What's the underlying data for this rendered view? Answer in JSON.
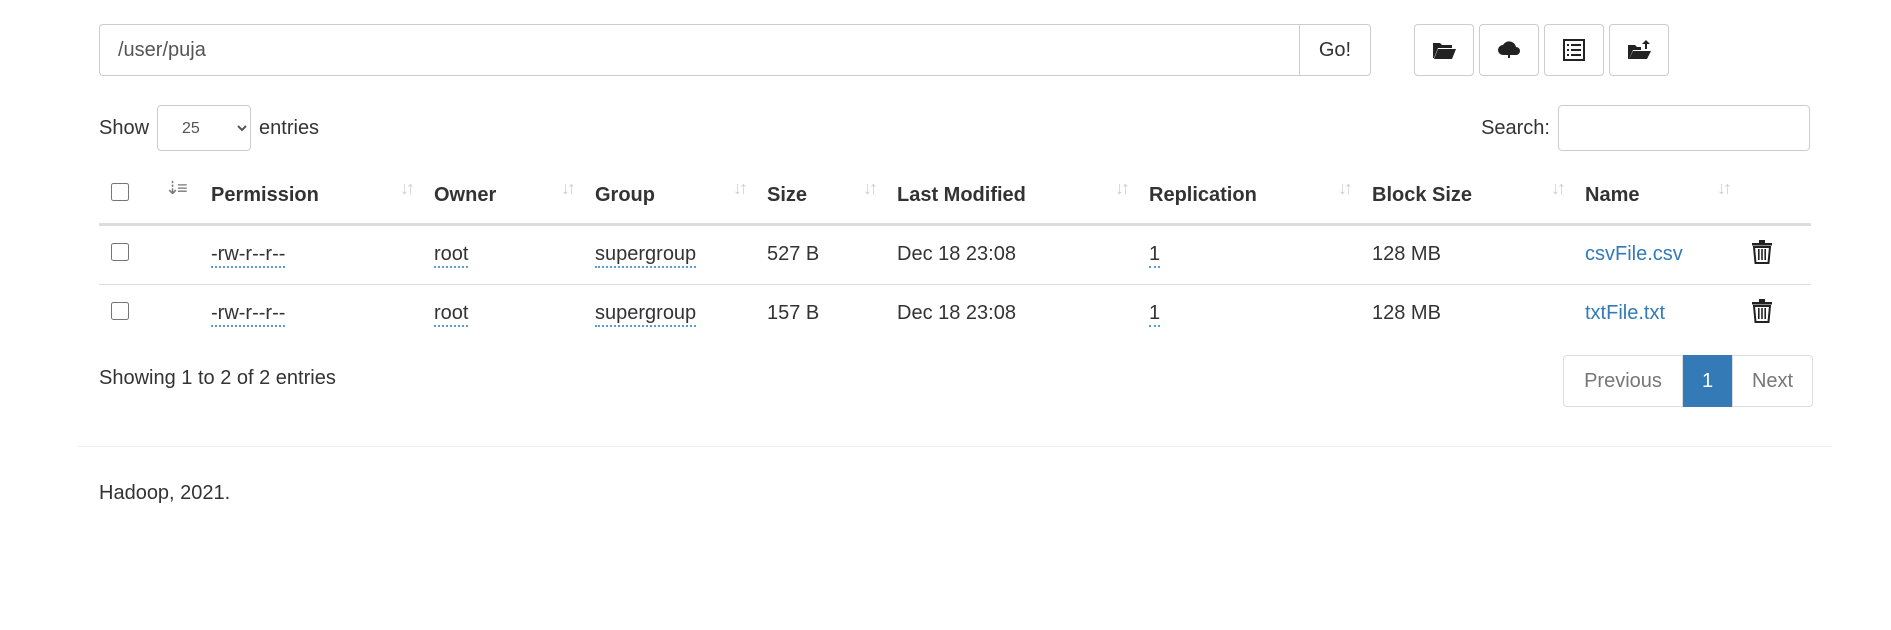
{
  "path": {
    "value": "/user/puja",
    "go_label": "Go!"
  },
  "toolbar": {
    "icons": [
      "folder-open-icon",
      "cloud-upload-icon",
      "list-alt-icon",
      "folder-upload-icon"
    ]
  },
  "length": {
    "show_label": "Show",
    "selected": "25",
    "entries_label": "entries"
  },
  "search": {
    "label": "Search:",
    "value": ""
  },
  "table": {
    "headers": [
      "Permission",
      "Owner",
      "Group",
      "Size",
      "Last Modified",
      "Replication",
      "Block Size",
      "Name"
    ],
    "rows": [
      {
        "permission": "-rw-r--r--",
        "owner": "root",
        "group": "supergroup",
        "size": "527 B",
        "modified": "Dec 18 23:08",
        "replication": "1",
        "block_size": "128 MB",
        "name": "csvFile.csv"
      },
      {
        "permission": "-rw-r--r--",
        "owner": "root",
        "group": "supergroup",
        "size": "157 B",
        "modified": "Dec 18 23:08",
        "replication": "1",
        "block_size": "128 MB",
        "name": "txtFile.txt"
      }
    ]
  },
  "info": "Showing 1 to 2 of 2 entries",
  "pagination": {
    "previous": "Previous",
    "current": "1",
    "next": "Next"
  },
  "footer": "Hadoop, 2021.",
  "colors": {
    "link": "#337ab7",
    "active_page": "#337ab7",
    "border": "#dddddd"
  }
}
